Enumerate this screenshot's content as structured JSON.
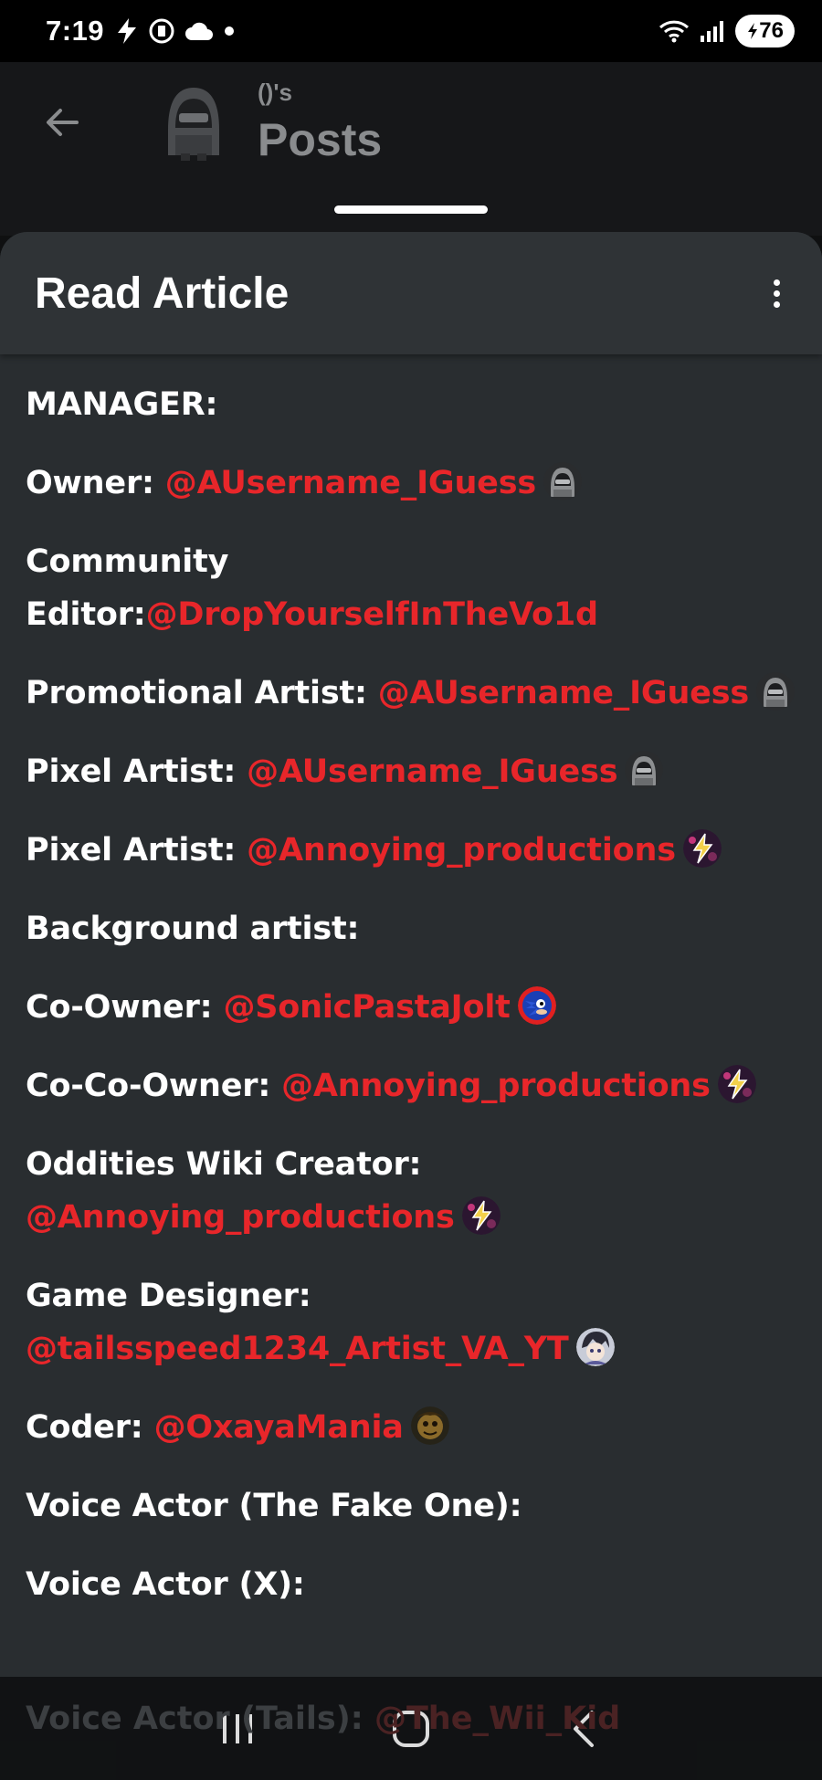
{
  "status_bar": {
    "time": "7:19",
    "battery": "76",
    "icons": [
      "flash-icon",
      "media-icon",
      "cloud-icon",
      "dot-icon",
      "wifi-icon",
      "signal-icon"
    ]
  },
  "header": {
    "subtitle": "()'s",
    "title": "Posts"
  },
  "sheet": {
    "title": "Read Article"
  },
  "article": {
    "lines": [
      {
        "label": "MANAGER:",
        "mention": "",
        "avatar": ""
      },
      {
        "label": "Owner: ",
        "mention": "@AUsername_IGuess",
        "avatar": "hooded"
      },
      {
        "label": "Community Editor:",
        "mention": "@DropYourselfInTheVo1d",
        "avatar": ""
      },
      {
        "label": "Promotional Artist: ",
        "mention": "@AUsername_IGuess",
        "avatar": "hooded"
      },
      {
        "label": "Pixel Artist: ",
        "mention": "@AUsername_IGuess",
        "avatar": "hooded"
      },
      {
        "label": "Pixel Artist: ",
        "mention": "@Annoying_productions",
        "avatar": "bolt"
      },
      {
        "label": "Background artist:",
        "mention": "",
        "avatar": ""
      },
      {
        "label": "Co-Owner: ",
        "mention": "@SonicPastaJolt",
        "avatar": "sonic"
      },
      {
        "label": "Co-Co-Owner: ",
        "mention": "@Annoying_productions",
        "avatar": "bolt"
      },
      {
        "label": "Oddities Wiki Creator: ",
        "mention": "@Annoying_productions",
        "avatar": "bolt"
      },
      {
        "label": "Game Designer: ",
        "mention": "@tailsspeed1234_Artist_VA_YT",
        "avatar": "anime"
      },
      {
        "label": "Coder: ",
        "mention": "@OxayaMania",
        "avatar": "face"
      },
      {
        "label": "Voice Actor (The Fake One):",
        "mention": "",
        "avatar": ""
      },
      {
        "label": "Voice Actor (X):",
        "mention": "",
        "avatar": ""
      }
    ],
    "faded_line": {
      "label": "Voice Actor (Tails): ",
      "mention": "@The_Wii_Kid"
    }
  },
  "colors": {
    "mention": "#e8262a",
    "sheet_bg": "#292d30",
    "header_bg": "#2f3336"
  }
}
